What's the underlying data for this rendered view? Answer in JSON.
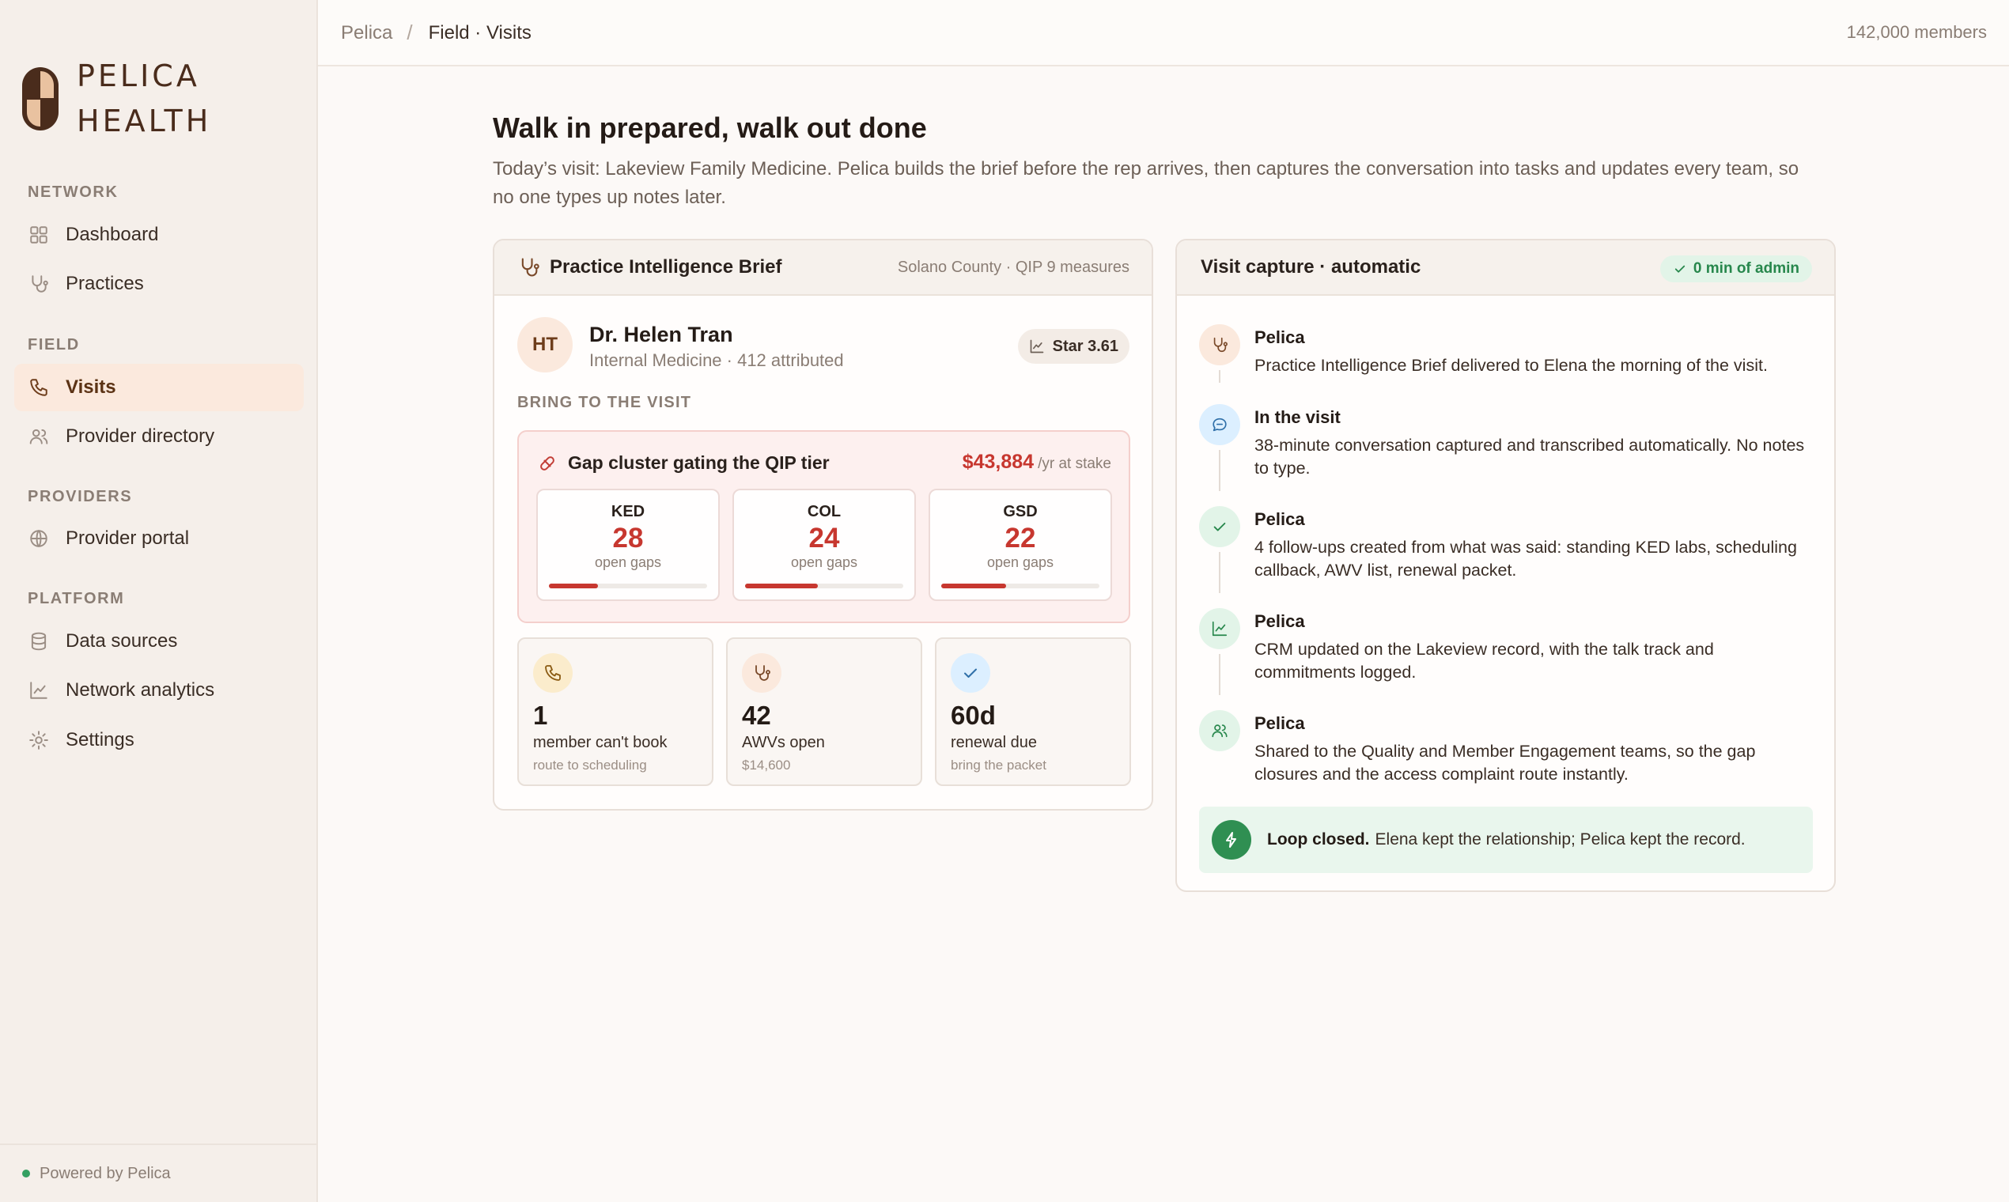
{
  "brand": {
    "line1": "PELICA",
    "line2": "HEALTH"
  },
  "sidebar": {
    "sections": [
      {
        "label": "NETWORK"
      },
      {
        "label": "FIELD"
      },
      {
        "label": "PROVIDERS"
      },
      {
        "label": "PLATFORM"
      }
    ],
    "items": [
      {
        "label": "Dashboard",
        "icon": "dashboard-icon"
      },
      {
        "label": "Practices",
        "icon": "stethoscope-icon"
      },
      {
        "label": "Visits",
        "icon": "phone-icon",
        "active": true
      },
      {
        "label": "Provider directory",
        "icon": "users-icon"
      },
      {
        "label": "Provider portal",
        "icon": "globe-icon"
      },
      {
        "label": "Data sources",
        "icon": "database-icon"
      },
      {
        "label": "Network analytics",
        "icon": "chart-line-icon"
      },
      {
        "label": "Settings",
        "icon": "gear-icon"
      }
    ],
    "footer": "Powered by Pelica"
  },
  "topbar": {
    "breadcrumb_root": "Pelica",
    "breadcrumb_sep": "/",
    "breadcrumb_current": "Field · Visits",
    "members": "142,000 members"
  },
  "page": {
    "title": "Walk in prepared, walk out done",
    "subtitle": "Today’s visit: Lakeview Family Medicine. Pelica builds the brief before the rep arrives, then captures the conversation into tasks and updates every team, so no one types up notes later."
  },
  "brief": {
    "title": "Practice Intelligence Brief",
    "meta": "Solano County · QIP 9 measures",
    "doctor": {
      "initials": "HT",
      "name": "Dr. Helen Tran",
      "subtitle": "Internal Medicine · 412 attributed",
      "star": "Star 3.61"
    },
    "bring_label": "BRING TO THE VISIT",
    "gap": {
      "title": "Gap cluster gating the QIP tier",
      "amount": "$43,884",
      "amount_unit": "/yr at stake",
      "measures": [
        {
          "code": "KED",
          "value": "28",
          "label": "open gaps",
          "fill": 0.31
        },
        {
          "code": "COL",
          "value": "24",
          "label": "open gaps",
          "fill": 0.46
        },
        {
          "code": "GSD",
          "value": "22",
          "label": "open gaps",
          "fill": 0.41
        }
      ]
    },
    "stats": [
      {
        "value": "1",
        "label": "member can't book",
        "sub": "route to scheduling",
        "icon": "phone-icon"
      },
      {
        "value": "42",
        "label": "AWVs open",
        "sub": "$14,600",
        "icon": "stethoscope-icon"
      },
      {
        "value": "60d",
        "label": "renewal due",
        "sub": "bring the packet",
        "icon": "check-icon"
      }
    ]
  },
  "capture": {
    "title": "Visit capture · automatic",
    "badge": "0 min of admin",
    "timeline": [
      {
        "actor": "Pelica",
        "text": "Practice Intelligence Brief delivered to Elena the morning of the visit.",
        "icon": "stethoscope-icon"
      },
      {
        "actor": "In the visit",
        "text": "38-minute conversation captured and transcribed automatically. No notes to type.",
        "icon": "chat-icon"
      },
      {
        "actor": "Pelica",
        "text": "4 follow-ups created from what was said: standing KED labs, scheduling callback, AWV list, renewal packet.",
        "icon": "check-icon"
      },
      {
        "actor": "Pelica",
        "text": "CRM updated on the Lakeview record, with the talk track and commitments logged.",
        "icon": "chart-line-icon"
      },
      {
        "actor": "Pelica",
        "text": "Shared to the Quality and Member Engagement teams, so the gap closures and the access complaint route instantly.",
        "icon": "users-icon"
      }
    ],
    "loop_strong": "Loop closed.",
    "loop_text": "Elena kept the relationship; Pelica kept the record."
  },
  "colors": {
    "accent": "#6e3d1b",
    "danger": "#c7372f",
    "success": "#2f8f52",
    "sidebar_bg": "#f5efea"
  }
}
